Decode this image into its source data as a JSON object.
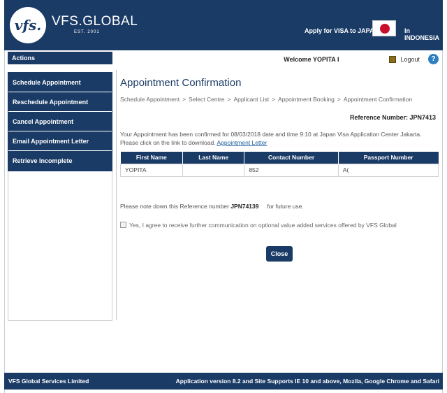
{
  "header": {
    "logo_text": "vfs.",
    "brand": "VFS.GLOBAL",
    "brand_sub": "EST. 2001",
    "apply_text": "Apply for VISA to JAPAN",
    "country_text": "In INDONESIA"
  },
  "sidebar": {
    "actions_title": "Actions",
    "items": [
      {
        "label": "Schedule Appointment"
      },
      {
        "label": "Reschedule Appointment"
      },
      {
        "label": "Cancel Appointment"
      },
      {
        "label": "Email Appointment Letter"
      },
      {
        "label": "Retrieve Incomplete Appointments"
      }
    ]
  },
  "topbar": {
    "welcome": "Welcome YOPITA I",
    "logout": "Logout",
    "help": "?"
  },
  "main": {
    "title": "Appointment Confirmation",
    "breadcrumb": [
      "Schedule Appointment",
      "Select Centre",
      "Applicant List",
      "Appointment Booking",
      "Appointment Confirmation"
    ],
    "breadcrumb_sep": ">",
    "reference": "Reference Number: JPN7413",
    "message_line1": "Your Appointment has been confirmed for 08/03/2018 date and time 9:10 at Japan Visa Application Center Jakarta.",
    "message_line2": "Please click on the link to download.",
    "letter_link": "Appointment Letter",
    "table": {
      "headers": [
        "First Name",
        "Last Name",
        "Contact Number",
        "Passport Number"
      ],
      "rows": [
        [
          "YOPITA",
          "",
          "852",
          "A("
        ]
      ]
    },
    "note_prefix": "Please note down this Reference number",
    "note_ref": "JPN74139",
    "note_suffix": "for future use.",
    "consent": "Yes, I agree to receive further communication on optional value added services offered by VFS Global",
    "close": "Close"
  },
  "footer": {
    "left": "VFS Global Services Limited",
    "right": "Application version 8.2 and Site Supports IE 10 and above, Mozila, Google Chrome and Safari"
  }
}
